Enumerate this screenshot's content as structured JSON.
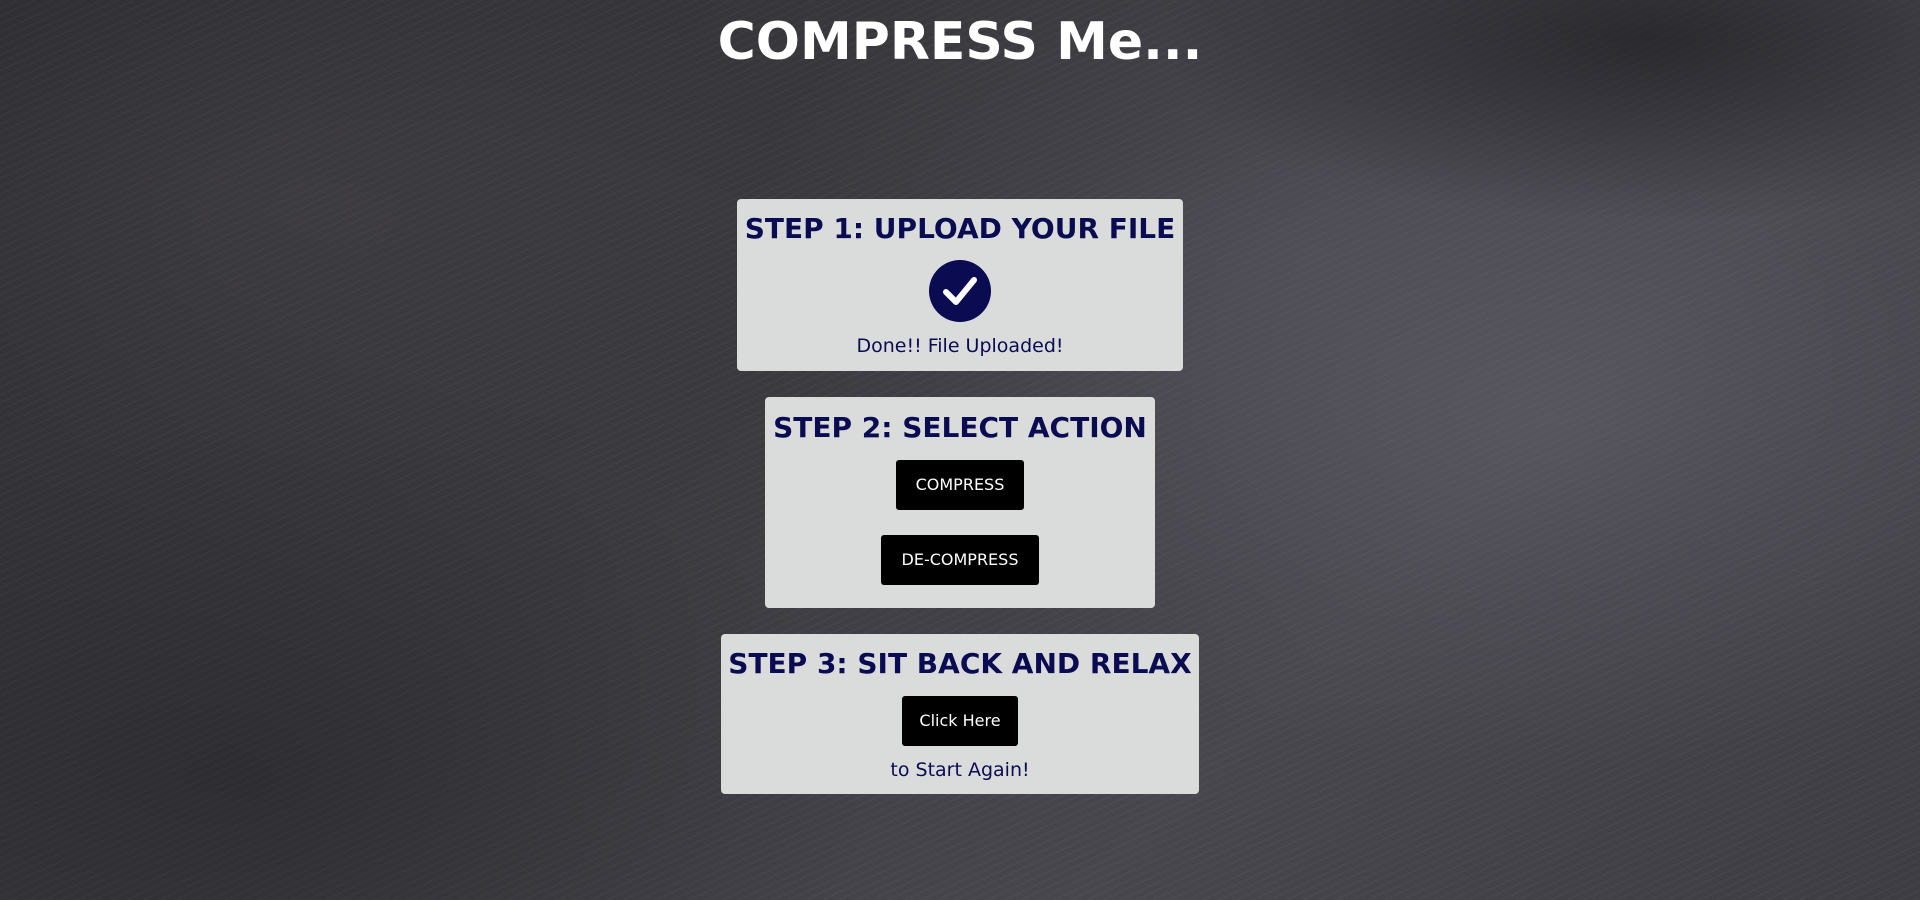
{
  "page": {
    "title": "COMPRESS Me..."
  },
  "step1": {
    "title": "STEP 1: UPLOAD YOUR FILE",
    "icon": "check-circle-icon",
    "status_text": "Done!! File Uploaded!"
  },
  "step2": {
    "title": "STEP 2: SELECT ACTION",
    "compress_label": "COMPRESS",
    "decompress_label": "DE-COMPRESS"
  },
  "step3": {
    "title": "STEP 3: SIT BACK AND RELAX",
    "restart_label": "Click Here",
    "restart_text": "to Start Again!"
  },
  "colors": {
    "card_background": "#dadcdb",
    "text_navy": "#0b0b52",
    "button_black": "#000000",
    "title_white": "#ffffff"
  }
}
